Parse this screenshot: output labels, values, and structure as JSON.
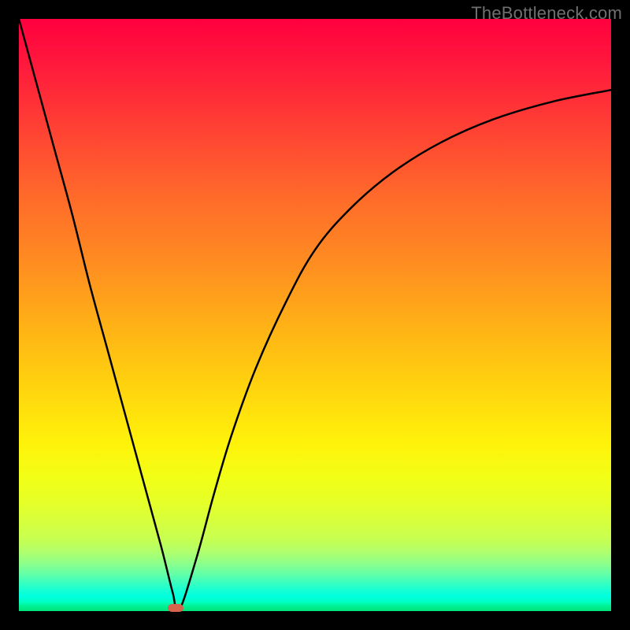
{
  "watermark": "TheBottleneck.com",
  "chart_data": {
    "type": "line",
    "title": "",
    "xlabel": "",
    "ylabel": "",
    "xlim": [
      0,
      100
    ],
    "ylim": [
      0,
      100
    ],
    "series": [
      {
        "name": "curve",
        "x": [
          0,
          3,
          6,
          9,
          12,
          15,
          18,
          21,
          24,
          26,
          27,
          30,
          33,
          36,
          40,
          45,
          50,
          56,
          63,
          71,
          80,
          90,
          100
        ],
        "values": [
          100,
          89,
          78,
          67,
          55,
          44,
          33,
          22,
          11,
          3,
          0,
          9,
          20,
          30,
          41,
          52,
          61,
          68,
          74,
          79,
          83,
          86,
          88
        ]
      }
    ],
    "marker": {
      "x": 26.5,
      "y": 0.5
    },
    "grid": false,
    "legend": false
  },
  "colors": {
    "curve_stroke": "#000000",
    "marker_fill": "#d6634c"
  }
}
